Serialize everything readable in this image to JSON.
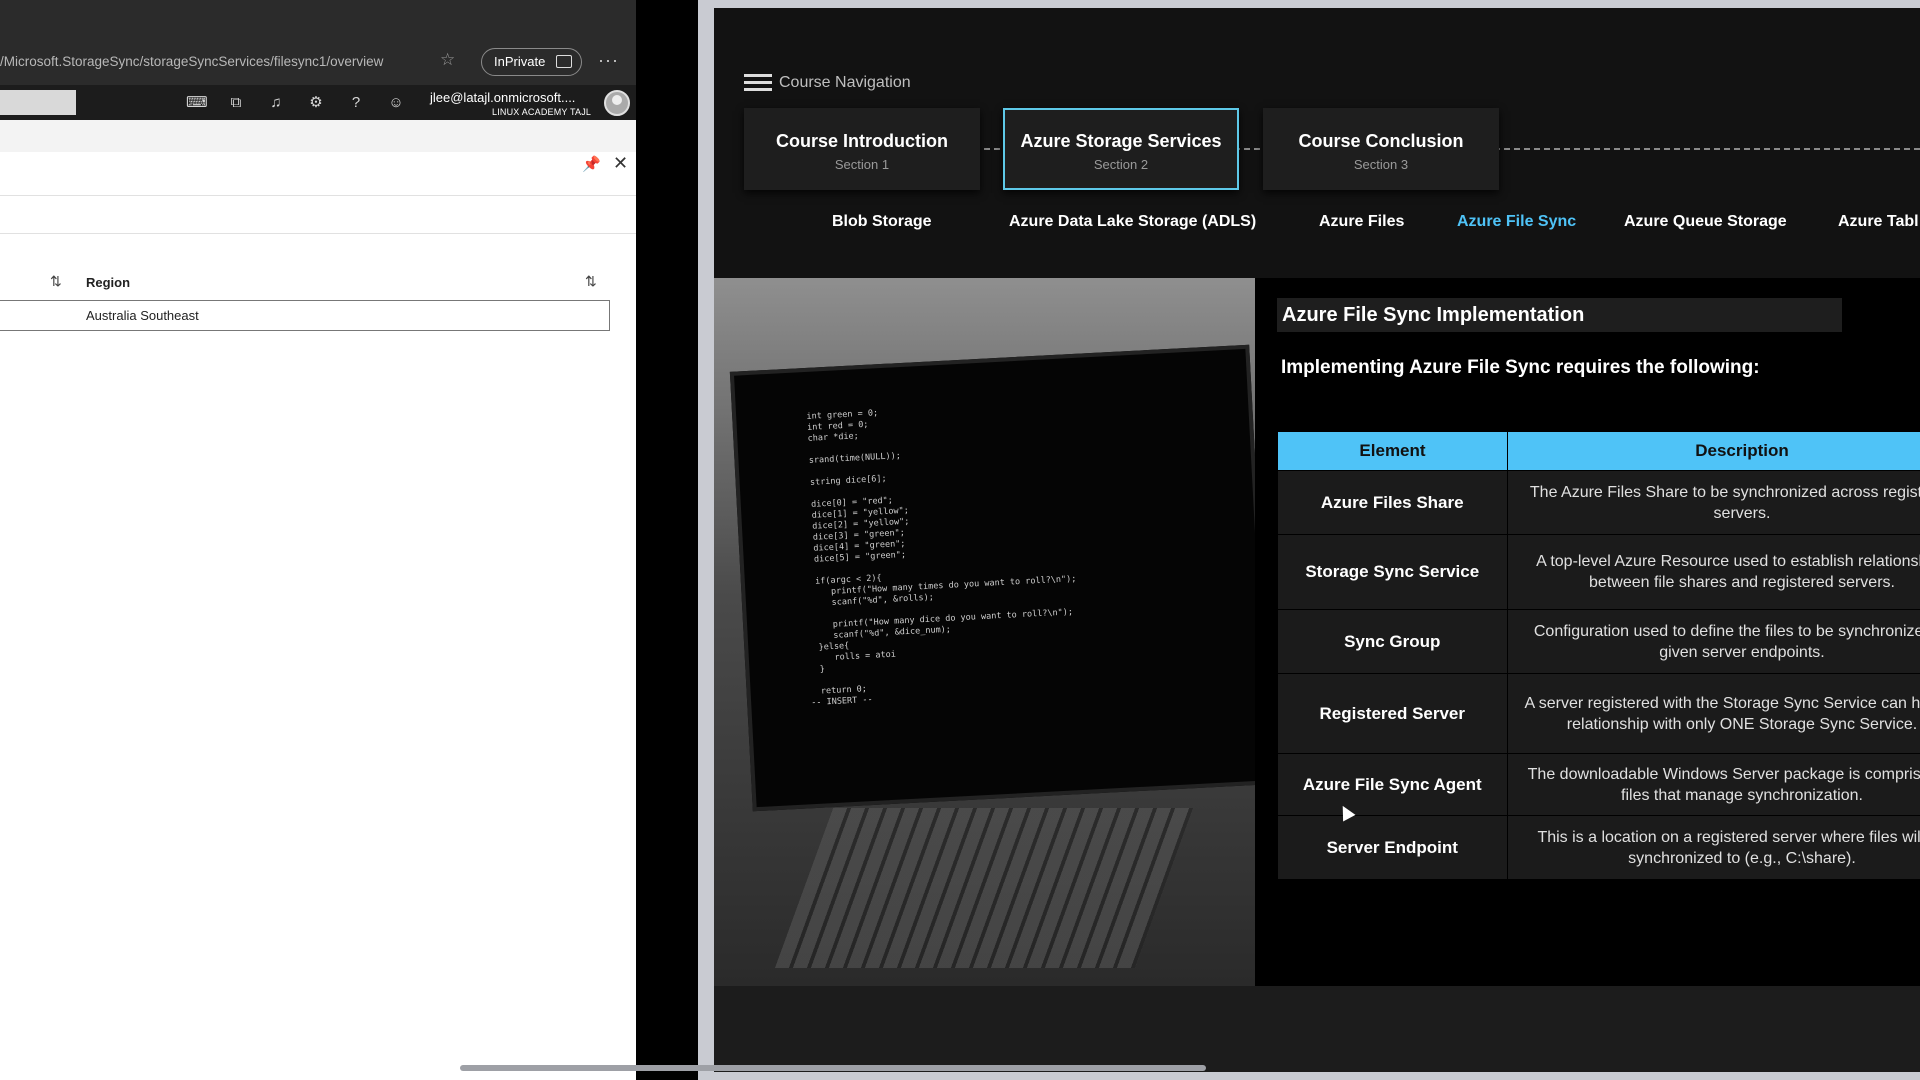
{
  "browser": {
    "url": "/Microsoft.StorageSync/storageSyncServices/filesync1/overview",
    "inprivate_label": "InPrivate",
    "more_label": "···"
  },
  "portal": {
    "user_email": "jlee@latajl.onmicrosoft....",
    "user_org": "LINUX ACADEMY TAJL"
  },
  "blade": {
    "column_region": "Region",
    "region_value": "Australia Southeast"
  },
  "course": {
    "nav_label": "Course Navigation",
    "sections": [
      {
        "title": "Course Introduction",
        "sub": "Section 1"
      },
      {
        "title": "Azure Storage Services",
        "sub": "Section 2"
      },
      {
        "title": "Course Conclusion",
        "sub": "Section 3"
      }
    ],
    "topics": [
      "Blob Storage",
      "Azure Data Lake Storage (ADLS)",
      "Azure Files",
      "Azure File Sync",
      "Azure Queue Storage",
      "Azure Tabl"
    ],
    "active_topic": "Azure File Sync"
  },
  "slide": {
    "heading": "Azure File Sync Implementation",
    "intro": "Implementing Azure File Sync requires the following:",
    "table_headers": [
      "Element",
      "Description"
    ],
    "rows": [
      {
        "element": "Azure Files Share",
        "description": "The Azure Files Share to be synchronized across registered servers."
      },
      {
        "element": "Storage Sync Service",
        "description": "A top-level Azure Resource used to establish relationships between file shares and registered servers."
      },
      {
        "element": "Sync Group",
        "description": "Configuration used to define the files to be synchronized to given server endpoints."
      },
      {
        "element": "Registered Server",
        "description": "A server registered with the Storage Sync Service can have a relationship with only ONE Storage Sync Service."
      },
      {
        "element": "Azure File Sync Agent",
        "description": "The downloadable Windows Server package is comprised of files that manage synchronization."
      },
      {
        "element": "Server Endpoint",
        "description": "This is a location on a registered server where files will be synchronized to (e.g., C:\\share)."
      }
    ]
  },
  "colors": {
    "accent": "#4fc3f7",
    "player_bg": "#121212",
    "active_border": "#5ec9e8"
  },
  "icons": [
    "star-icon",
    "inprivate-icon",
    "cloud-shell-icon",
    "directory-filter-icon",
    "bell-icon",
    "gear-icon",
    "help-icon",
    "feedback-icon",
    "pin-icon",
    "close-icon",
    "sort-icon",
    "list-icon"
  ]
}
